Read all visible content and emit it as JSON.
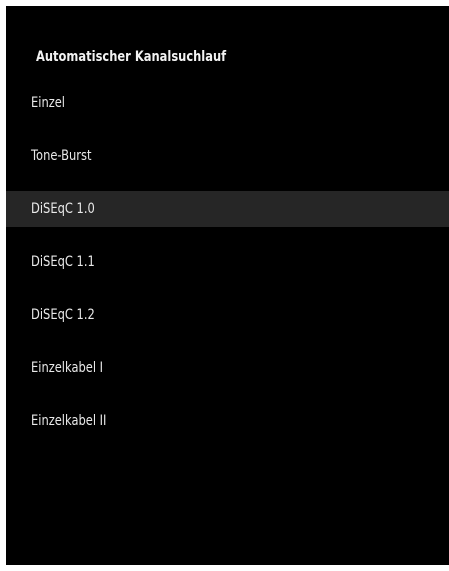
{
  "menu": {
    "title": "Automatischer Kanalsuchlauf",
    "selected_index": 2,
    "options": [
      {
        "label": "Einzel"
      },
      {
        "label": "Tone-Burst"
      },
      {
        "label": "DiSEqC 1.0"
      },
      {
        "label": "DiSEqC 1.1"
      },
      {
        "label": "DiSEqC 1.2"
      },
      {
        "label": "Einzelkabel I"
      },
      {
        "label": "Einzelkabel II"
      }
    ]
  },
  "colors": {
    "background": "#000000",
    "text": "#e9e9e9",
    "highlight": "#262626"
  }
}
